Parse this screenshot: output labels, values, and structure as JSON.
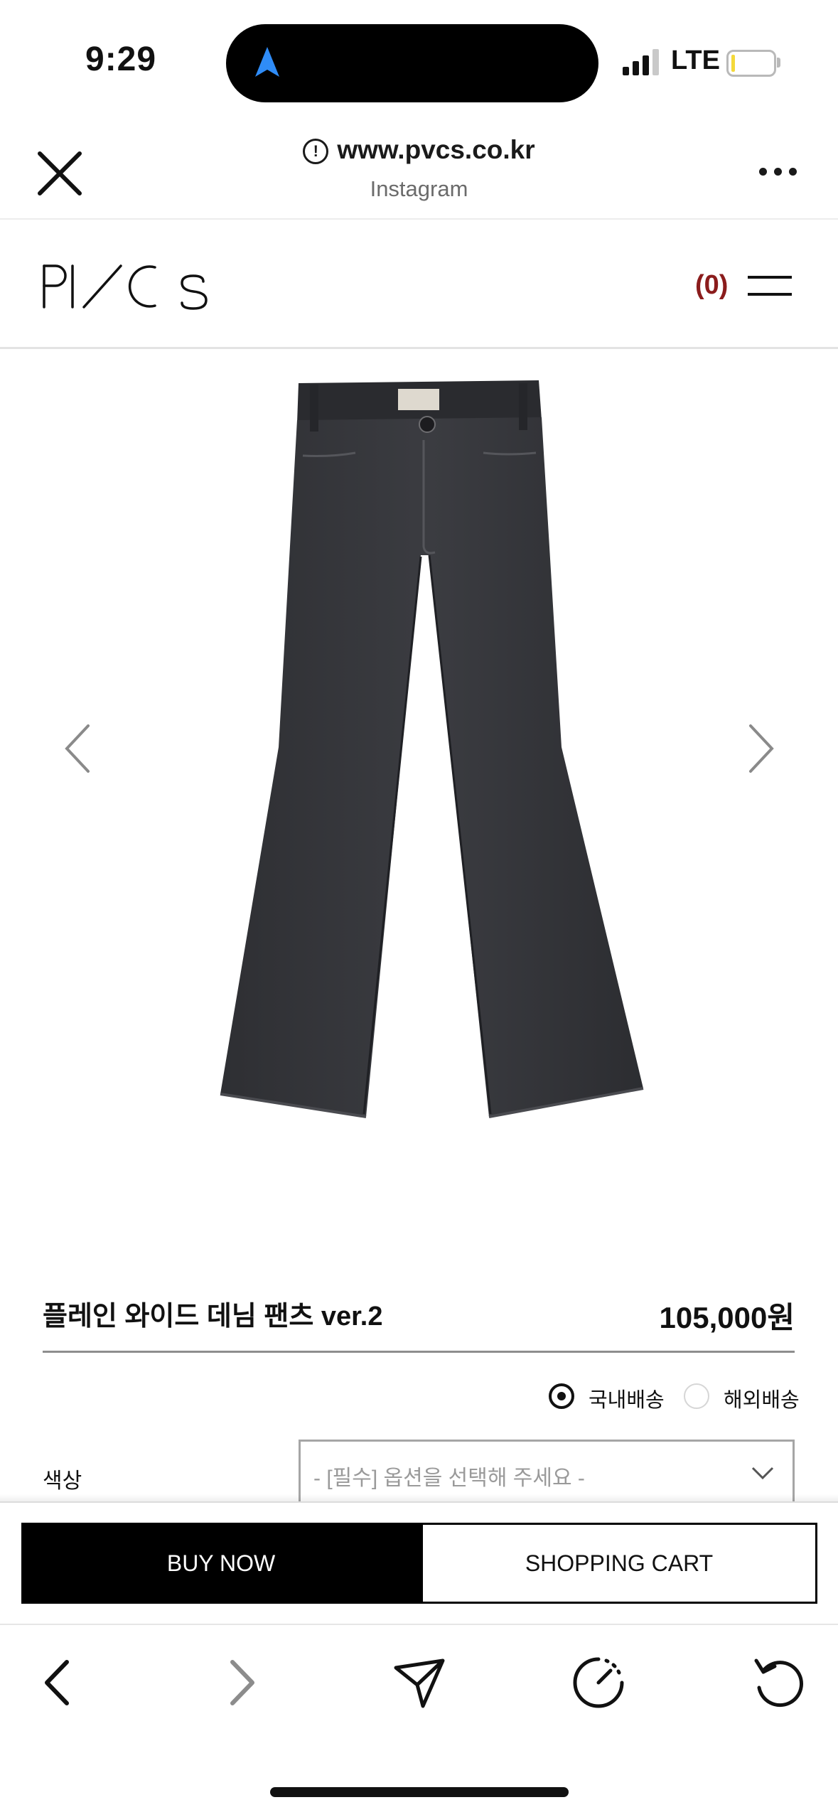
{
  "status_bar": {
    "time": "9:29",
    "network": "LTE",
    "icons": [
      "location-arrow-icon",
      "signal-icon",
      "battery-icon"
    ]
  },
  "browser": {
    "url": "www.pvcs.co.kr",
    "source": "Instagram",
    "icons": [
      "close-icon",
      "info-icon",
      "more-icon"
    ]
  },
  "site_header": {
    "logo_text": "PVCS",
    "cart_count": "(0)",
    "icons": [
      "menu-icon"
    ]
  },
  "gallery": {
    "image_alt": "black wide denim pants",
    "icons": [
      "chevron-left-icon",
      "chevron-right-icon"
    ]
  },
  "product": {
    "name": "플레인 와이드 데님 팬츠 ver.2",
    "price": "105,000원"
  },
  "shipping": {
    "options": [
      {
        "label": "국내배송",
        "selected": true
      },
      {
        "label": "해외배송",
        "selected": false
      }
    ]
  },
  "option": {
    "label": "색상",
    "placeholder": "- [필수] 옵션을 선택해 주세요 -"
  },
  "actions": {
    "buy_now": "BUY NOW",
    "shopping_cart": "SHOPPING CART"
  },
  "toolbar": {
    "icons": [
      "back-icon",
      "forward-icon",
      "share-icon",
      "speed-icon",
      "reload-icon"
    ]
  },
  "colors": {
    "accent_cart_count": "#8b1c1c",
    "buy_button_bg": "#000000",
    "island_arrow": "#2f8cf7"
  }
}
